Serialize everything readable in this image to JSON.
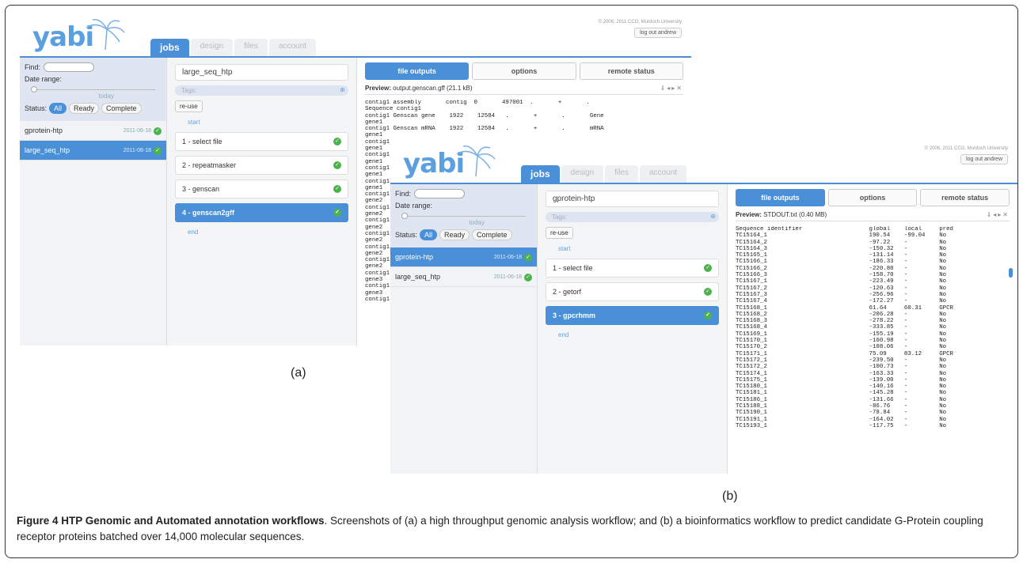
{
  "screenA": {
    "copyright": "© 2006, 2011 CCG, Murdoch University",
    "logout": "log out andrew",
    "logo": "yabi",
    "tabs": [
      "jobs",
      "design",
      "files",
      "account"
    ],
    "find_label": "Find:",
    "date_range_label": "Date range:",
    "today": "today",
    "status_label": "Status:",
    "status_pills": [
      "All",
      "Ready",
      "Complete"
    ],
    "jobs": [
      {
        "name": "gprotein-htp",
        "date": "2011-06-18"
      },
      {
        "name": "large_seq_htp",
        "date": "2011-06-18"
      }
    ],
    "job_name": "large_seq_htp",
    "tags_placeholder": "Tags:",
    "reuse": "re-use",
    "start": "start",
    "end": "end",
    "steps": [
      "1 - select file",
      "2 - repeatmasker",
      "3 - genscan",
      "4 - genscan2gff"
    ],
    "buttons": [
      "file outputs",
      "options",
      "remote status"
    ],
    "preview_label": "Preview:",
    "preview_file": "output.genscan.gff (21.1 kB)",
    "preview_text": "contig1 assembly       contig  0       497001  .       +       .\nSequence contig1\ncontig1 Genscan gene    1922    12584   .       +       .       Gene\ngene1\ncontig1 Genscan mRNA    1922    12584   .       +       .       mRNA\ngene1\ncontig1 G\ngene1\ncontig1 G\ngene1\ncontig1 G\ngene1\ncontig1 G\ngene1\ncontig1 G\ngene2\ncontig1 G\ngene2\ncontig1 G\ngene2\ncontig1 G\ngene2\ncontig1 G\ngene2\ncontig1 G\ngene2\ncontig1 G\ngene3\ncontig1 G\ngene3\ncontig1 G"
  },
  "screenB": {
    "copyright": "© 2006, 2011 CCG, Murdoch University",
    "logout": "log out andrew",
    "logo": "yabi",
    "tabs": [
      "jobs",
      "design",
      "files",
      "account"
    ],
    "find_label": "Find:",
    "date_range_label": "Date range:",
    "today": "today",
    "status_label": "Status:",
    "status_pills": [
      "All",
      "Ready",
      "Complete"
    ],
    "jobs": [
      {
        "name": "gprotein-htp",
        "date": "2011-06-18"
      },
      {
        "name": "large_seq_htp",
        "date": "2011-06-18"
      }
    ],
    "job_name": "gprotein-htp",
    "tags_placeholder": "Tags:",
    "reuse": "re-use",
    "start": "start",
    "end": "end",
    "steps": [
      "1 - select file",
      "2 - getorf",
      "3 - gpcrhmm"
    ],
    "buttons": [
      "file outputs",
      "options",
      "remote status"
    ],
    "preview_label": "Preview:",
    "preview_file": "STDOUT.txt (0.40 MB)",
    "preview_text": "Sequence identifier                   global    local     pred\nTC15164_1                             190.54    -99.04    No\nTC15164_2                             -97.22    -         No\nTC15164_3                             -150.32   -         No\nTC15165_1                             -131.14   -         No\nTC15166_1                             -186.33   -         No\nTC15166_2                             -220.80   -         No\nTC15166_3                             -158.70   -         No\nTC15167_1                             -223.49   -         No\nTC15167_2                             -120.63   -         No\nTC15167_3                             -256.96   -         No\nTC15167_4                             -172.27   -         No\nTC15168_1                             61.64     60.31     GPCR\nTC15168_2                             -206.28   -         No\nTC15168_3                             -278.22   -         No\nTC15168_4                             -333.85   -         No\nTC15169_1                             -155.19   -         No\nTC15170_1                             -160.98   -         No\nTC15170_2                             -108.06   -         No\nTC15171_1                             75.09     83.12     GPCR\nTC15172_1                             -239.50   -         No\nTC15172_2                             -100.73   -         No\nTC15174_1                             -163.33   -         No\nTC15175_1                             -139.00   -         No\nTC15180_1                             -140.16   -         No\nTC15181_1                             -145.28   -         No\nTC15186_1                             -131.66   -         No\nTC15188_1                             -86.76    -         No\nTC15190_1                             -78.84    -         No\nTC15191_1                             -164.02   -         No\nTC15193_1                             -117.75   -         No"
  },
  "labels": {
    "a": "(a)",
    "b": "(b)"
  },
  "caption": {
    "title": "Figure 4 HTP Genomic and Automated annotation workflows",
    "text": ". Screenshots of (a) a high throughput genomic analysis workflow; and (b) a bioinformatics workflow to predict candidate G-Protein coupling receptor proteins batched over 14,000 molecular sequences."
  },
  "colors": {
    "accent": "#4a90d9",
    "check": "#4bb34b"
  }
}
